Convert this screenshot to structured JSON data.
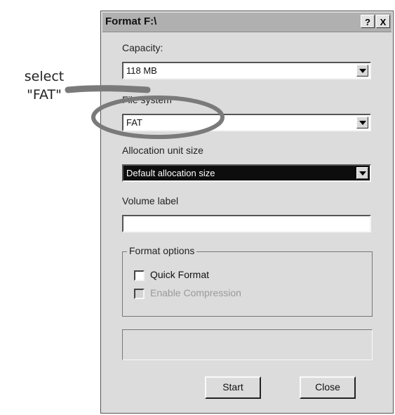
{
  "annotation": {
    "line1": "select",
    "line2": "\"FAT\""
  },
  "dialog": {
    "title": "Format F:\\",
    "help_label": "?",
    "close_label": "X",
    "capacity": {
      "label": "Capacity:",
      "value": "118 MB"
    },
    "file_system": {
      "label": "File system",
      "value": "FAT"
    },
    "allocation": {
      "label": "Allocation unit size",
      "value": "Default allocation size"
    },
    "volume_label": {
      "label": "Volume label",
      "value": ""
    },
    "format_options": {
      "title": "Format options",
      "quick_format": {
        "label": "Quick Format",
        "checked": false,
        "enabled": true
      },
      "enable_compression": {
        "label": "Enable Compression",
        "checked": false,
        "enabled": false
      }
    },
    "buttons": {
      "start": "Start",
      "close": "Close"
    }
  },
  "colors": {
    "dialog_bg": "#dcdcdc",
    "titlebar": "#b0b0b0",
    "selected_bg": "#0d0d0d",
    "annotation_stroke": "#7a7a7a"
  },
  "icons": {
    "dropdown": "chevron-down-icon",
    "help": "help-icon",
    "close": "close-icon"
  }
}
